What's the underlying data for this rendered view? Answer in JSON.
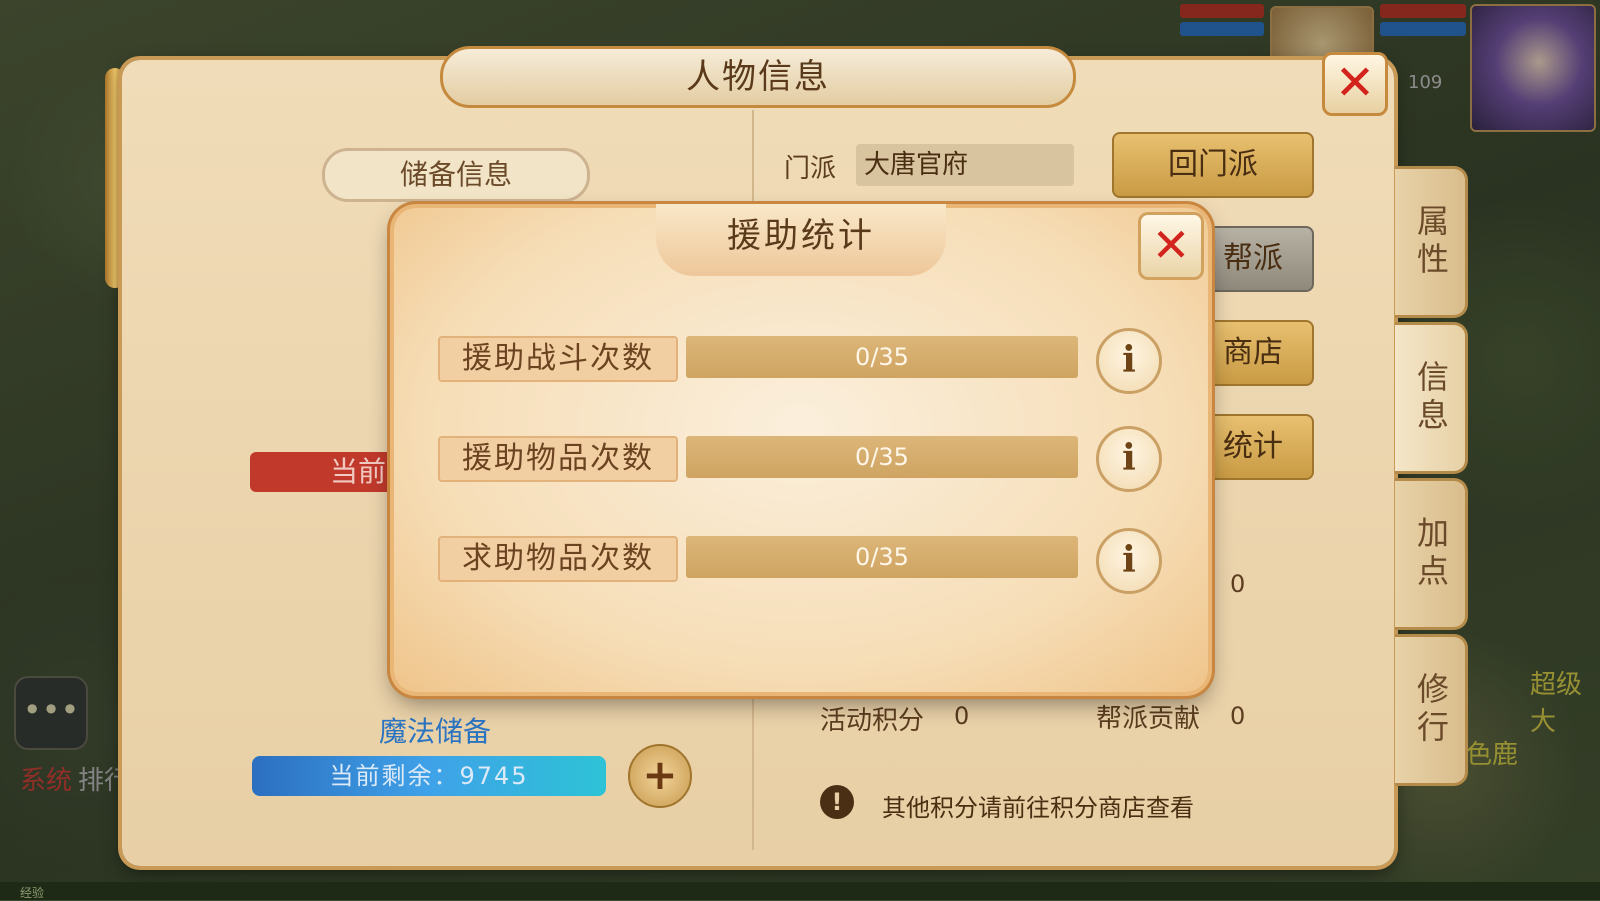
{
  "panel": {
    "title": "人物信息",
    "reserve_tab": "储备信息",
    "sect_label": "门派",
    "sect_value": "大唐官府",
    "buttons": [
      "回门派",
      "帮派",
      "商店",
      "统计"
    ],
    "side_tabs": [
      "属性",
      "信息",
      "加点",
      "修行"
    ],
    "current_red": "当前",
    "magic_title": "魔法储备",
    "mana_text": "当前剩余：9745",
    "stats": {
      "activity_label": "活动积分",
      "activity_value": "0",
      "guild_label": "帮派贡献",
      "guild_value": "0",
      "hidden_value": "0"
    },
    "notice": "其他积分请前往积分商店查看"
  },
  "hud": {
    "level": "109",
    "left_bg_text": "系统",
    "left_bg_text2": "排行",
    "right_bg_text": "超级大",
    "right_bg_text2": "色鹿",
    "xp_label": "经验"
  },
  "modal": {
    "title": "援助统计",
    "rows": [
      {
        "label": "援助战斗次数",
        "current": 0,
        "max": 35,
        "text": "0/35"
      },
      {
        "label": "援助物品次数",
        "current": 0,
        "max": 35,
        "text": "0/35"
      },
      {
        "label": "求助物品次数",
        "current": 0,
        "max": 35,
        "text": "0/35"
      }
    ]
  },
  "icons": {
    "close": "close-icon",
    "info": "info-icon",
    "plus": "plus-icon",
    "notice": "exclamation-icon",
    "chat": "chat-icon"
  },
  "colors": {
    "close_x": "#d2231c",
    "mana_blue": "#3fa2e8",
    "red_bar": "#c0392b",
    "gold_button": "#c99b44"
  }
}
